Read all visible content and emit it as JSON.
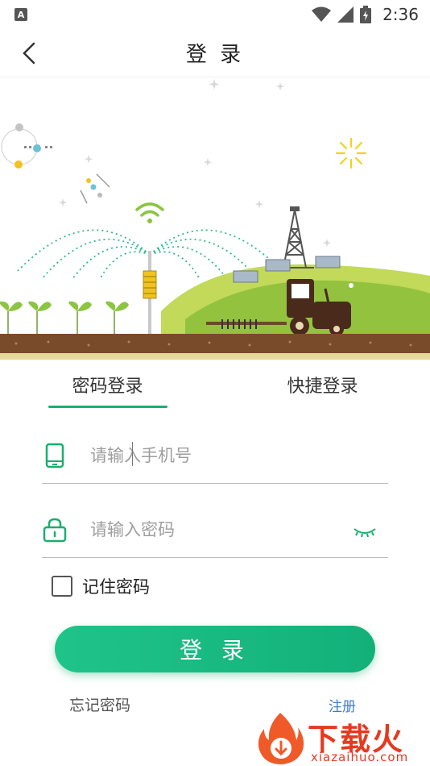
{
  "status_bar": {
    "app_badge": "A",
    "time": "2:36"
  },
  "header": {
    "title": "登 录"
  },
  "tabs": [
    {
      "label": "密码登录",
      "active": true
    },
    {
      "label": "快捷登录",
      "active": false
    }
  ],
  "form": {
    "phone_placeholder": "请输入手机号",
    "phone_value": "",
    "password_placeholder": "请输入密码",
    "password_value": "",
    "remember_label": "记住密码",
    "remember_checked": false,
    "login_label": "登 录",
    "forgot_label": "忘记密码",
    "register_label": "注册"
  },
  "watermark": {
    "text": "下载火",
    "sub": "xiazaihuo.com"
  },
  "colors": {
    "accent": "#1aae6f",
    "link": "#3a7bd5",
    "watermark": "#e53a1f"
  },
  "icons": {
    "back": "chevron-left-icon",
    "phone": "phone-icon",
    "lock": "lock-icon",
    "eye": "eye-closed-icon"
  }
}
